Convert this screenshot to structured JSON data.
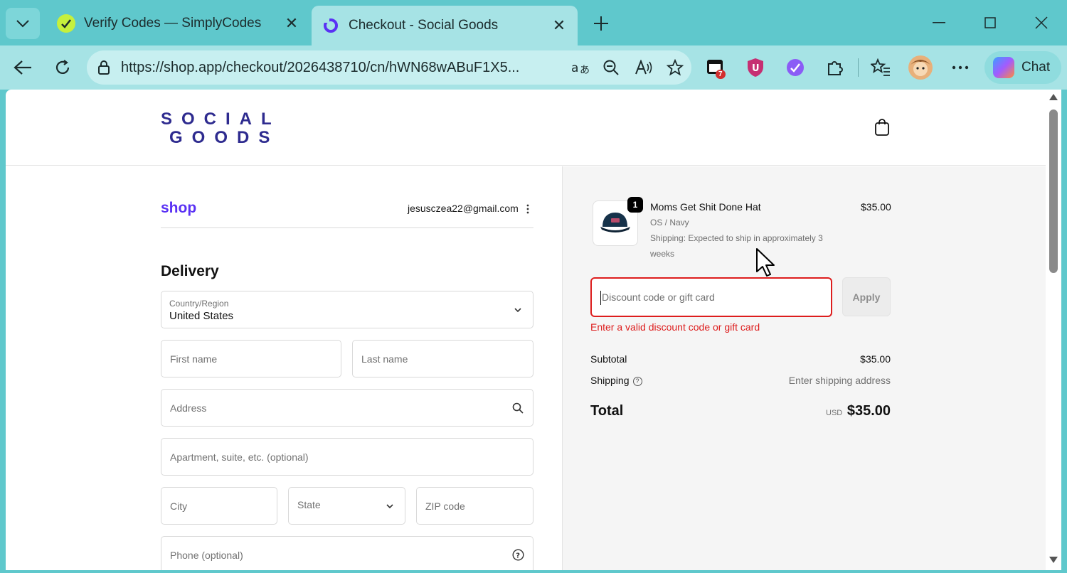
{
  "browser": {
    "tabs": [
      {
        "title": "Verify Codes — SimplyCodes",
        "active": false
      },
      {
        "title": "Checkout - Social Goods",
        "active": true
      }
    ],
    "url": "https://shop.app/checkout/2026438710/cn/hWN68wABuF1X5...",
    "extension_badge": "7",
    "chat_label": "Chat"
  },
  "store": {
    "logo_line1": "SOCIAL",
    "logo_line2": "GOODS",
    "brand_color": "#2e2b8f"
  },
  "account": {
    "shop_logo": "shop",
    "email": "jesusczea22@gmail.com"
  },
  "delivery": {
    "heading": "Delivery",
    "country_label": "Country/Region",
    "country_value": "United States",
    "first_name": "First name",
    "last_name": "Last name",
    "address": "Address",
    "apartment": "Apartment, suite, etc. (optional)",
    "city": "City",
    "state": "State",
    "zip": "ZIP code",
    "phone": "Phone (optional)"
  },
  "order": {
    "item": {
      "quantity": "1",
      "name": "Moms Get Shit Done Hat",
      "variant": "OS / Navy",
      "shipping_note": "Shipping: Expected to ship in approximately 3 weeks",
      "price": "$35.00"
    },
    "discount_placeholder": "Discount code or gift card",
    "apply_label": "Apply",
    "discount_error": "Enter a valid discount code or gift card",
    "subtotal_label": "Subtotal",
    "subtotal_value": "$35.00",
    "shipping_label": "Shipping",
    "shipping_value": "Enter shipping address",
    "total_label": "Total",
    "total_currency": "USD",
    "total_value": "$35.00",
    "error_color": "#dd1d1d"
  }
}
